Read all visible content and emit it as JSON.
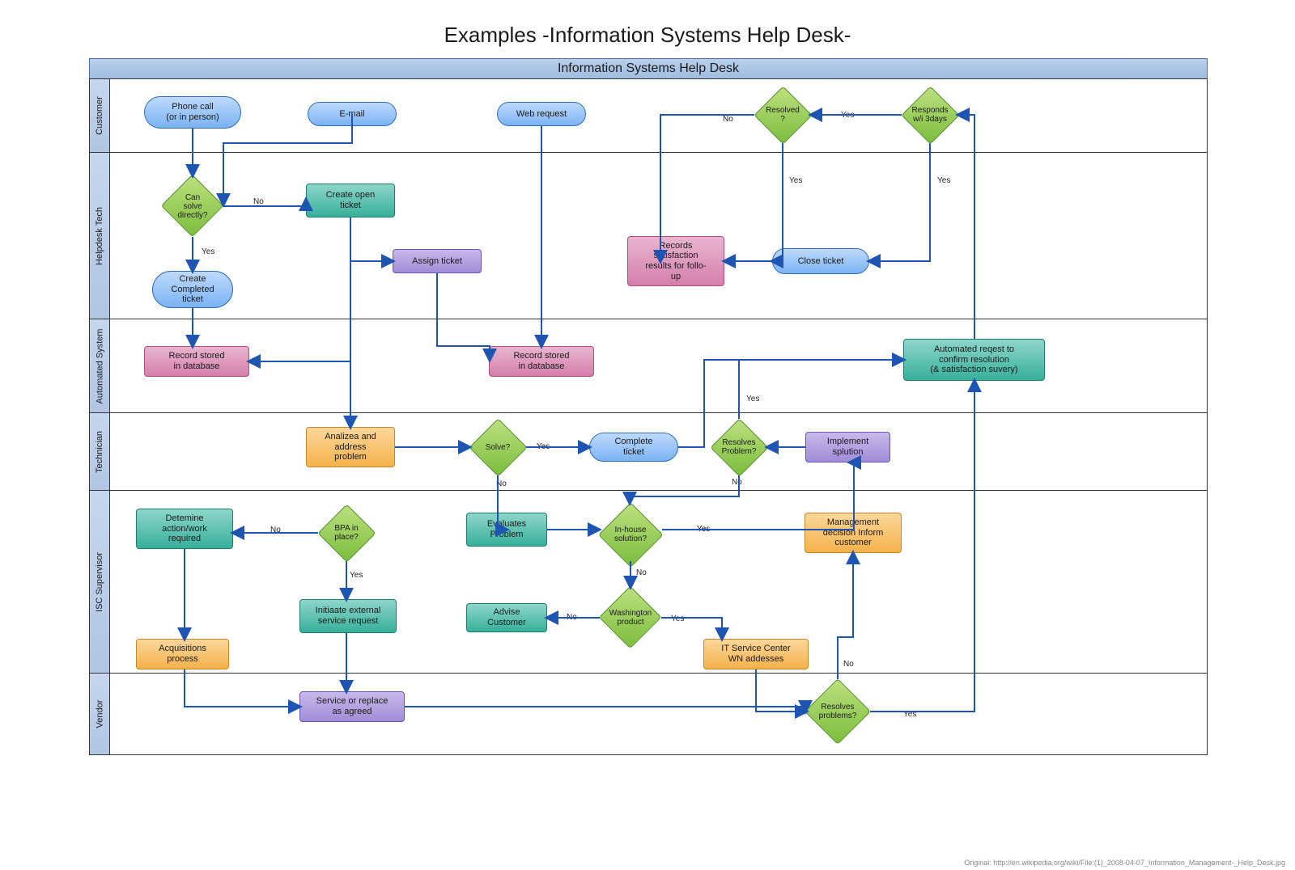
{
  "title": "Examples -Information Systems Help Desk-",
  "banner": "Information Systems Help Desk",
  "lanes": {
    "customer": "Customer",
    "helpdesk": "Helpdesk Tech",
    "auto": "Automated System",
    "tech": "Technician",
    "isc": "ISC Supervisor",
    "vendor": "Vendor"
  },
  "nodes": {
    "phone": "Phone call\n(or in person)",
    "email": "E-mail",
    "web": "Web request",
    "resolved": "Resolved\n?",
    "responds": "Responds\nw/i 3days",
    "cansolve": "Can\nsolve\ndirectly?",
    "openticket": "Create open\nticket",
    "assign": "Assign ticket",
    "closeticket": "Close ticket",
    "satisf": "Records\nsatisfaction\nresults for follo-\nup",
    "compticket": "Create\nCompleted\nticket",
    "recdb1": "Record stored\nin database",
    "recdb2": "Record stored\nin database",
    "autoreq": "Automated reqest to\nconfirm resolution\n(& satisfaction suvery)",
    "analyze": "Analizea and\naddress\nproblem",
    "solve": "Solve?",
    "complete": "Complete\nticket",
    "resprob": "Resolves\nProblem?",
    "implsol": "Implement\nsplution",
    "detwork": "Detemine\naction/work\nrequired",
    "bpa": "BPA in\nplace?",
    "evalprob": "Evaluates\nProblem",
    "inhouse": "In-house\nsolution?",
    "mgmt": "Management\ndecision Inform\ncustomer",
    "initext": "Initiaate external\nservice request",
    "advise": "Advise\nCustomer",
    "wprod": "Washington\nproduct",
    "itsc": "IT Service Center\nWN addesses",
    "acq": "Acquisitions\nprocess",
    "svcrep": "Service or replace\nas agreed",
    "resprob2": "Resolves\nproblems?"
  },
  "edge_labels": {
    "yes": "Yes",
    "no": "No"
  },
  "credit": "Original: http://en.wikipedia.org/wiki/File:(1)_2008-04-07_Information_Management-_Help_Desk.jpg"
}
